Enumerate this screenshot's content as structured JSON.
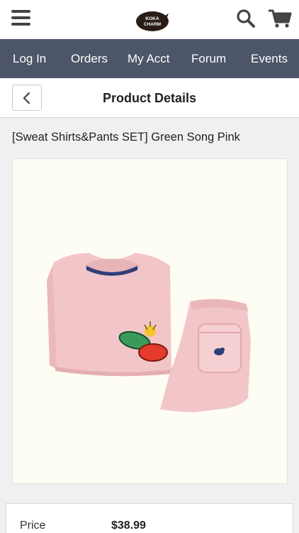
{
  "header": {
    "menu_icon": "hamburger-menu-icon",
    "logo_text_line1": "KOKA",
    "logo_text_line2": "CHARM",
    "search_icon": "search-icon",
    "cart_icon": "shopping-cart-icon"
  },
  "nav": {
    "items": [
      {
        "label": "Log In"
      },
      {
        "label": "Orders"
      },
      {
        "label": "My Acct"
      },
      {
        "label": "Forum"
      },
      {
        "label": "Events"
      }
    ]
  },
  "subheader": {
    "back_icon": "chevron-left-icon",
    "title": "Product Details"
  },
  "product": {
    "title": "[Sweat Shirts&Pants SET] Green Song Pink",
    "image_alt": "pink sweatshirt and pants set",
    "price_label": "Price",
    "price_value": "$38.99"
  },
  "colors": {
    "nav_bg": "#4d5568",
    "garment_pink": "#f2c6c8",
    "image_bg": "#fefdf3"
  }
}
